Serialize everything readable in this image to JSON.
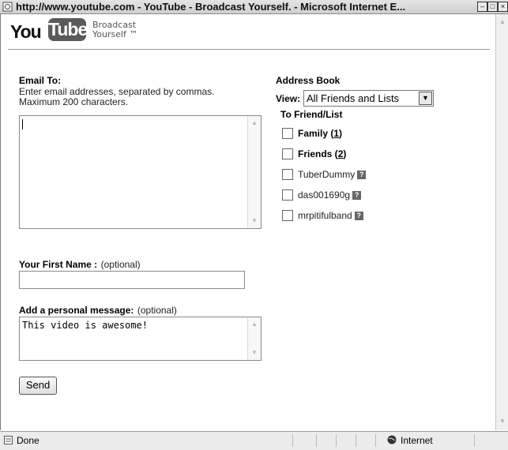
{
  "window": {
    "title": "http://www.youtube.com - YouTube - Broadcast Yourself. - Microsoft Internet E..."
  },
  "header": {
    "logo_you": "You",
    "logo_tube": "Tube",
    "tagline_line1": "Broadcast",
    "tagline_line2": "Yourself ™"
  },
  "email_to": {
    "label": "Email To:",
    "hint_line1": "Enter email addresses, separated by commas.",
    "hint_line2": "Maximum 200 characters.",
    "value": ""
  },
  "address_book": {
    "heading": "Address Book",
    "view_label": "View:",
    "view_selected": "All Friends and Lists",
    "column_header": "To  Friend/List",
    "entries": [
      {
        "name": "Family",
        "count": "1",
        "is_list": true
      },
      {
        "name": "Friends",
        "count": "2",
        "is_list": true
      },
      {
        "name": "TuberDummy",
        "is_list": false
      },
      {
        "name": "das001690g",
        "is_list": false
      },
      {
        "name": "mrpitifulband",
        "is_list": false
      }
    ]
  },
  "first_name": {
    "label": "Your First Name :",
    "optional": "(optional)",
    "value": ""
  },
  "message": {
    "label": "Add a personal message:",
    "optional": "(optional)",
    "value": "This video is awesome!"
  },
  "send_button": "Send",
  "status": {
    "left": "Done",
    "zone": "Internet"
  }
}
